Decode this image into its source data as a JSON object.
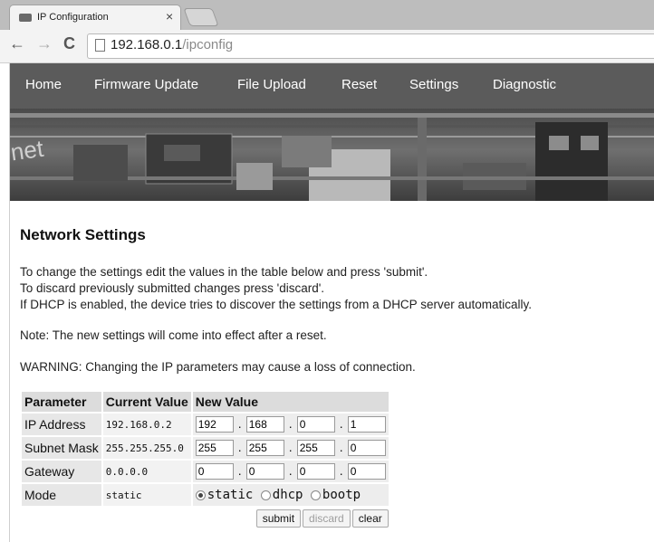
{
  "browser": {
    "tab_title": "IP Configuration",
    "tab_close": "×",
    "back": "←",
    "forward": "→",
    "reload": "C",
    "url_host": "192.168.0.1",
    "url_path": "/ipconfig"
  },
  "nav": {
    "items": [
      "Home",
      "Firmware Update",
      "File Upload",
      "Reset",
      "Settings",
      "Diagnostic"
    ]
  },
  "page": {
    "title": "Network Settings",
    "intro_lines": [
      "To change the settings edit the values in the table below and press 'submit'.",
      "To discard previously submitted changes press 'discard'.",
      "If DHCP is enabled, the device tries to discover the settings from a DHCP server automatically."
    ],
    "note": "Note: The new settings will come into effect after a reset.",
    "warning": "WARNING: Changing the IP parameters may cause a loss of connection."
  },
  "table": {
    "headers": [
      "Parameter",
      "Current Value",
      "New Value"
    ],
    "separator": ".",
    "rows": [
      {
        "label": "IP Address",
        "current": "192.168.0.2",
        "octets": [
          "192",
          "168",
          "0",
          "1"
        ]
      },
      {
        "label": "Subnet Mask",
        "current": "255.255.255.0",
        "octets": [
          "255",
          "255",
          "255",
          "0"
        ]
      },
      {
        "label": "Gateway",
        "current": "0.0.0.0",
        "octets": [
          "0",
          "0",
          "0",
          "0"
        ]
      }
    ],
    "mode": {
      "label": "Mode",
      "current": "static",
      "options": [
        "static",
        "dhcp",
        "bootp"
      ],
      "selected": "static"
    }
  },
  "buttons": {
    "submit": "submit",
    "discard": "discard",
    "clear": "clear"
  }
}
